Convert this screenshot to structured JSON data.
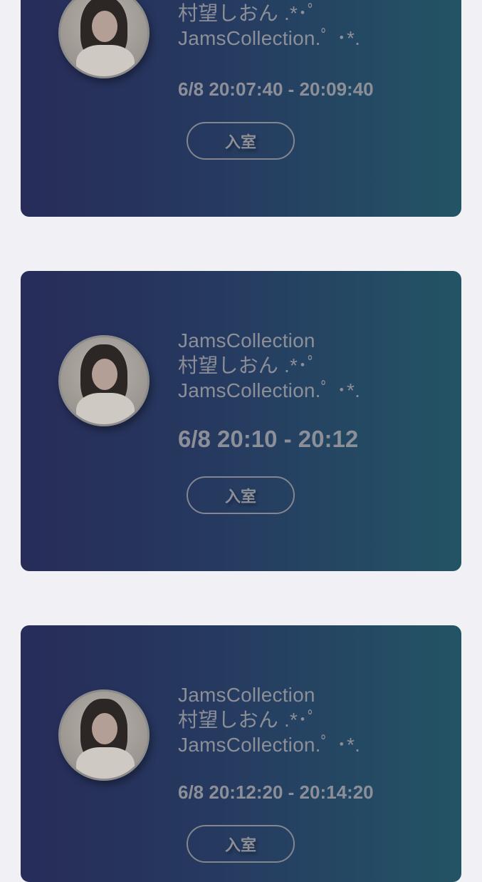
{
  "cards": [
    {
      "lines": [
        "村望しおん .*･ﾟ",
        "JamsCollection.ﾟ ･*."
      ],
      "time": "6/8 20:07:40 - 20:09:40",
      "button": "入室"
    },
    {
      "lines": [
        "JamsCollection",
        "村望しおん .*･ﾟ",
        "JamsCollection.ﾟ ･*."
      ],
      "time": "6/8 20:10 - 20:12",
      "button": "入室"
    },
    {
      "lines": [
        "JamsCollection",
        "村望しおん .*･ﾟ",
        "JamsCollection.ﾟ ･*."
      ],
      "time": "6/8 20:12:20 - 20:14:20",
      "button": "入室"
    }
  ]
}
